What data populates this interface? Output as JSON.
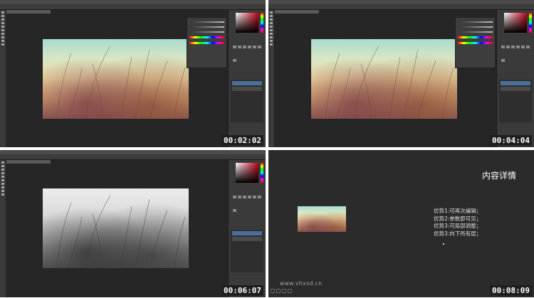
{
  "cells": [
    {
      "timestamp": "00:02:02",
      "variant": "color",
      "has_props": true
    },
    {
      "timestamp": "00:04:04",
      "variant": "color",
      "has_props": true
    },
    {
      "timestamp": "00:06:07",
      "variant": "bw",
      "has_props": false
    }
  ],
  "slide": {
    "title": "内容详情",
    "bullets": [
      "优势1:可再次编辑；",
      "优势2:参数即可见；",
      "优势3:可局部调整；",
      "优势3:向下所有层；"
    ],
    "site": "www.vhxsd.cn",
    "timestamp": "00:08:09"
  },
  "icons": [
    "tool-icon",
    "hue-slider",
    "adjustment-icon"
  ],
  "colors": {
    "bg": "#262626",
    "accent": "#4b6e9b",
    "picker_red": "#c00018"
  }
}
